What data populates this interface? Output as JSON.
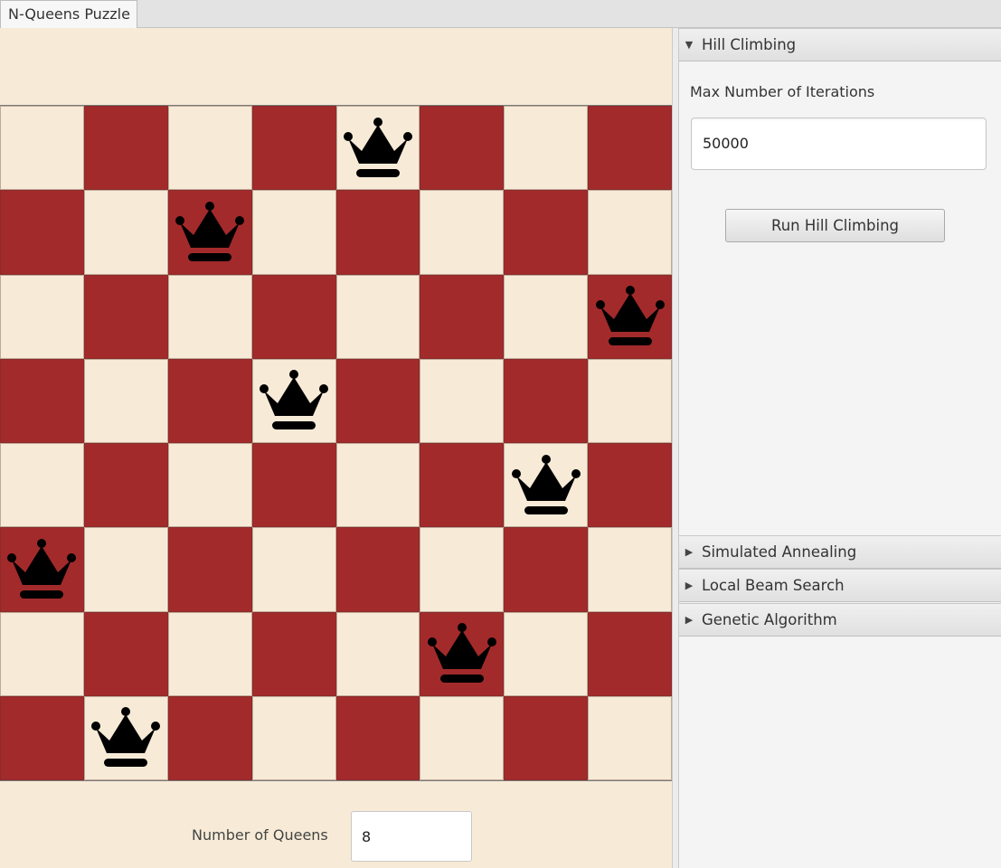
{
  "window": {
    "tab_title": "N-Queens Puzzle"
  },
  "board": {
    "size": 8,
    "light_color": "#f7ebd7",
    "dark_color": "#a32a2b",
    "queen_icon": "crown-icon",
    "queen_columns_by_row": [
      4,
      2,
      7,
      3,
      6,
      0,
      5,
      1
    ]
  },
  "controls": {
    "num_queens_label": "Number of Queens",
    "num_queens_value": "8"
  },
  "sidebar": {
    "panes": [
      {
        "title": "Hill Climbing",
        "expanded": true
      },
      {
        "title": "Simulated Annealing",
        "expanded": false
      },
      {
        "title": "Local Beam Search",
        "expanded": false
      },
      {
        "title": "Genetic Algorithm",
        "expanded": false
      }
    ],
    "hill_climbing": {
      "iterations_label": "Max Number of Iterations",
      "iterations_value": "50000",
      "run_button": "Run Hill Climbing"
    }
  }
}
